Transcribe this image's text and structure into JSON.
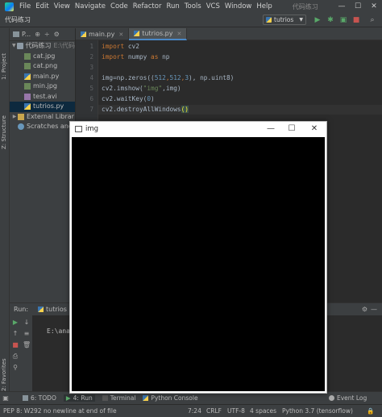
{
  "menubar": {
    "items": [
      "File",
      "Edit",
      "View",
      "Navigate",
      "Code",
      "Refactor",
      "Run",
      "Tools",
      "VCS",
      "Window",
      "Help"
    ],
    "window_title": "代码练习",
    "minimize": "—",
    "maximize": "☐",
    "close": "✕"
  },
  "navbar": {
    "project_name": "代码练习",
    "run_config": "tutrios",
    "run_icon": "▶",
    "debug_icon": "✱",
    "stop_icon": "■"
  },
  "left_strip": {
    "project_tab": "1: Project",
    "structure_tab": "Z: Structure",
    "favorites_tab": "2: Favorites"
  },
  "project_panel": {
    "header_label": "P...",
    "root": {
      "name": "代码练习",
      "path": "E:\\代码"
    },
    "files": [
      {
        "name": "cat.jpg",
        "type": "img"
      },
      {
        "name": "cat.png",
        "type": "img"
      },
      {
        "name": "main.py",
        "type": "py"
      },
      {
        "name": "min.jpg",
        "type": "img"
      },
      {
        "name": "test.avi",
        "type": "avi"
      },
      {
        "name": "tutrios.py",
        "type": "py"
      }
    ],
    "external_libraries": "External Librar",
    "scratches": "Scratches and"
  },
  "editor": {
    "tabs": [
      "main.py",
      "tutrios.py"
    ],
    "active_tab": "tutrios.py",
    "line_numbers": [
      "1",
      "2",
      "3",
      "4",
      "5",
      "6",
      "7"
    ]
  },
  "code": {
    "l1_kw": "import",
    "l1_rest": " cv2",
    "l2_kw": "import",
    "l2_mid": " numpy ",
    "l2_kw2": "as",
    "l2_rest": " np",
    "l4_a": "img=np.zeros((",
    "l4_n1": "512",
    "l4_b": ",",
    "l4_n2": "512",
    "l4_c": ",",
    "l4_n3": "3",
    "l4_d": "), np.uint8)",
    "l5_a": "cv2.imshow(",
    "l5_s": "\"img\"",
    "l5_b": ",img)",
    "l6_a": "cv2.waitKey(",
    "l6_n": "0",
    "l6_b": ")",
    "l7_a": "cv2.destroyAllWindows",
    "l7_b": "()"
  },
  "run_panel": {
    "label": "Run:",
    "tab": "tutrios",
    "output": "E:\\ana"
  },
  "bottom_tabs": {
    "todo": "6: TODO",
    "run": "4: Run",
    "terminal": "Terminal",
    "python_console": "Python Console",
    "event_log": "Event Log"
  },
  "statusbar": {
    "message": "PEP 8: W292 no newline at end of file",
    "position": "7:24",
    "line_sep": "CRLF",
    "encoding": "UTF-8",
    "indent": "4 spaces",
    "interpreter": "Python 3.7 (tensorflow)"
  },
  "cv_window": {
    "title": "img",
    "minimize": "—",
    "maximize": "☐",
    "close": "✕",
    "image_color": "#000000"
  }
}
